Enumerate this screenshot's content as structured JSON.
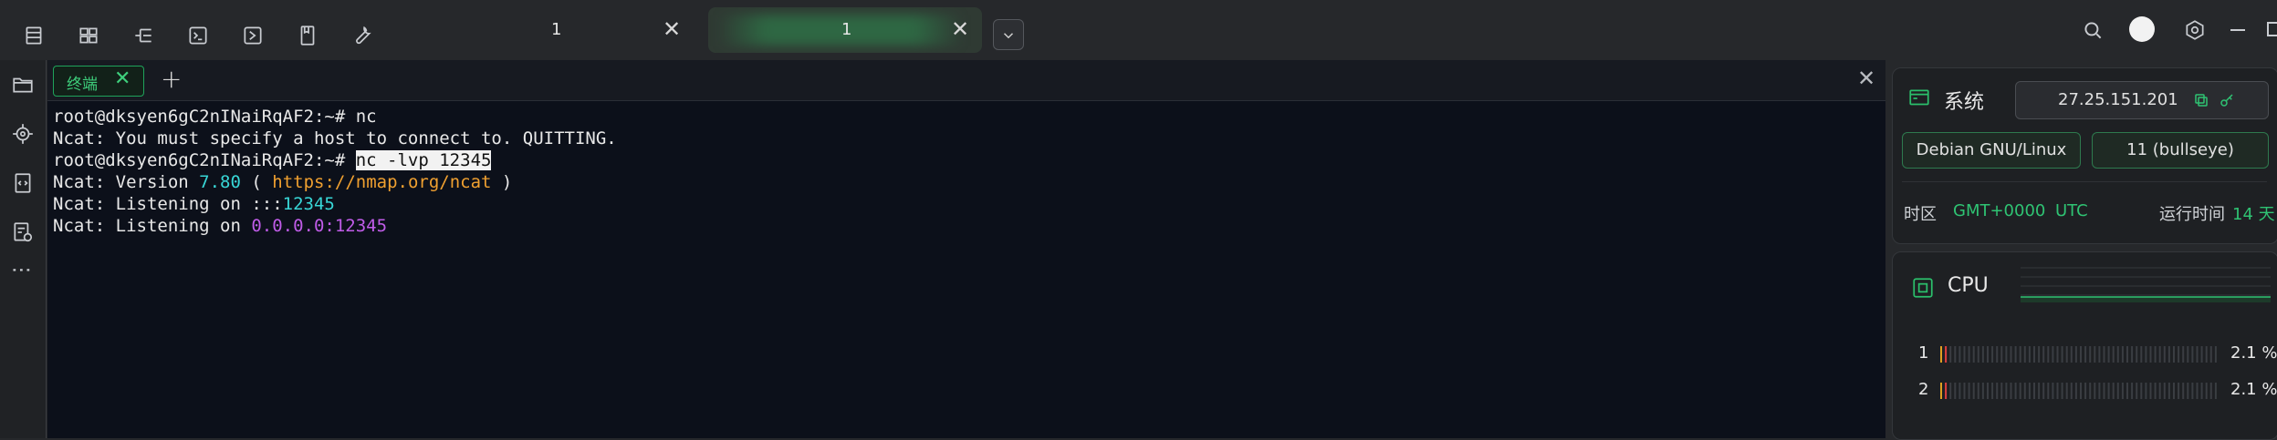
{
  "toolbar": {
    "icons": [
      "list-icon",
      "layout-icon",
      "tree-icon",
      "terminal-icon",
      "terminal-run-icon",
      "book-icon",
      "wrench-icon"
    ]
  },
  "tabs": [
    {
      "label": "1",
      "close": "✕",
      "active": false
    },
    {
      "label": "1",
      "close": "✕",
      "active": true
    }
  ],
  "window": {
    "icons": [
      "search-icon",
      "avatar",
      "settings-icon",
      "minimize-icon",
      "maximize-icon"
    ]
  },
  "sidebar": {
    "icons": [
      "folder-icon",
      "target-icon",
      "code-file-icon",
      "file-settings-icon"
    ],
    "more": "⋮"
  },
  "terminal": {
    "tab_label": "终端",
    "tab_close": "✕",
    "add": "+",
    "close": "✕",
    "lines": {
      "l1_prompt": "root@dksyen6gC2nINaiRqAF2:~# ",
      "l1_cmd": "nc",
      "l2": "Ncat: You must specify a host to connect to. QUITTING.",
      "l3_prompt": "root@dksyen6gC2nINaiRqAF2:~# ",
      "l3_cmd": "nc -lvp 12345",
      "l4_a": "Ncat: Version ",
      "l4_ver": "7.80",
      "l4_b": " ( ",
      "l4_url": "https://nmap.org/ncat",
      "l4_c": " )",
      "l5_a": "Ncat: Listening on :::",
      "l5_port": "12345",
      "l6_a": "Ncat: Listening on ",
      "l6_addr": "0.0.0.0:12345"
    }
  },
  "system": {
    "title": "系统",
    "ip": "27.25.151.201",
    "os": "Debian GNU/Linux",
    "version": "11 (bullseye)",
    "tz_label": "时区",
    "tz_value": "GMT+0000",
    "tz_name": "UTC",
    "uptime_label": "运行时间",
    "uptime_value": "14 天"
  },
  "cpu": {
    "title": "CPU",
    "cores": [
      {
        "label": "1",
        "value": "2.1 %",
        "usage": 0.021
      },
      {
        "label": "2",
        "value": "2.1 %",
        "usage": 0.021
      }
    ]
  },
  "colors": {
    "accent": "#2fc373",
    "terminal_bg": "#0c101a"
  }
}
